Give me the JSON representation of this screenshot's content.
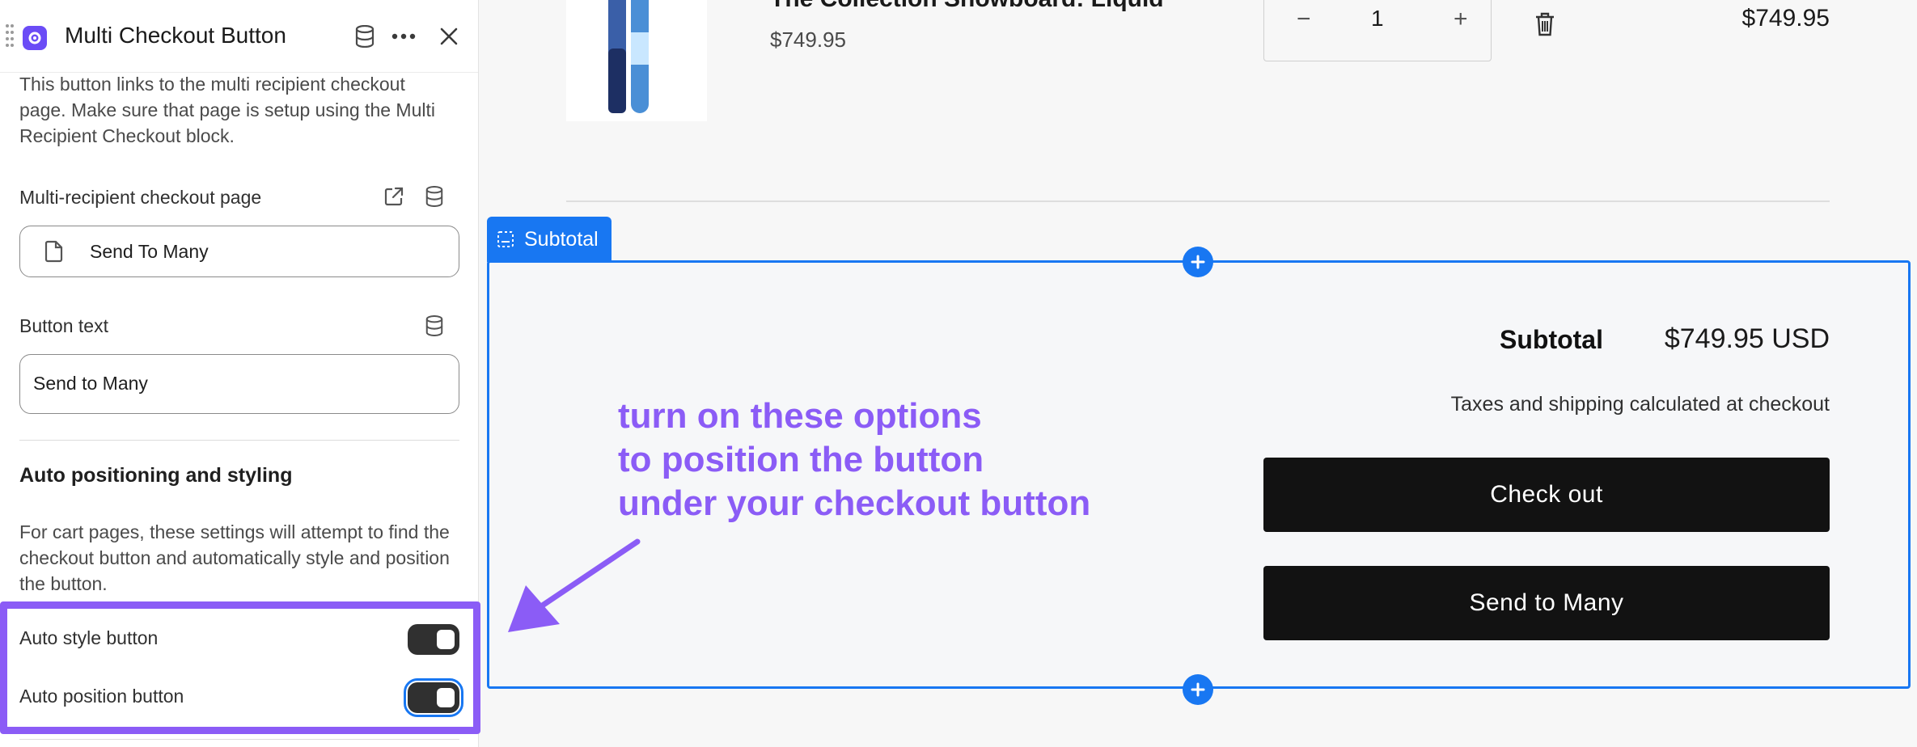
{
  "panel": {
    "title": "Multi Checkout Button",
    "description": "This button links to the multi recipient checkout page. Make sure that page is setup using the Multi Recipient Checkout block.",
    "checkout_page_label": "Multi-recipient checkout page",
    "checkout_page_value": "Send To Many",
    "button_text_label": "Button text",
    "button_text_value": "Send to Many",
    "section_title": "Auto positioning and styling",
    "section_description": "For cart pages, these settings will attempt to find the checkout button and automatically style and position the button.",
    "toggles": [
      {
        "label": "Auto style button",
        "on": true
      },
      {
        "label": "Auto position button",
        "on": true
      }
    ],
    "icons": {
      "app": "app-logo-icon",
      "database": "database-icon",
      "more": "more-dots-icon",
      "close": "close-icon",
      "external": "external-link-icon",
      "page": "page-icon"
    }
  },
  "preview": {
    "product": {
      "title": "The Collection Snowboard: Liquid",
      "price": "$749.95",
      "quantity": "1",
      "line_total": "$749.95",
      "decrement": "−",
      "increment": "+"
    },
    "section_tag": "Subtotal",
    "subtotal_label": "Subtotal",
    "subtotal_value": "$749.95 USD",
    "tax_note": "Taxes and shipping calculated at checkout",
    "checkout_button": "Check out",
    "send_button": "Send to Many",
    "annotation": "turn on these options\nto position the button\nunder your checkout button"
  },
  "colors": {
    "accent": "#8b5cf6",
    "selection": "#1877f2",
    "button": "#121212"
  }
}
